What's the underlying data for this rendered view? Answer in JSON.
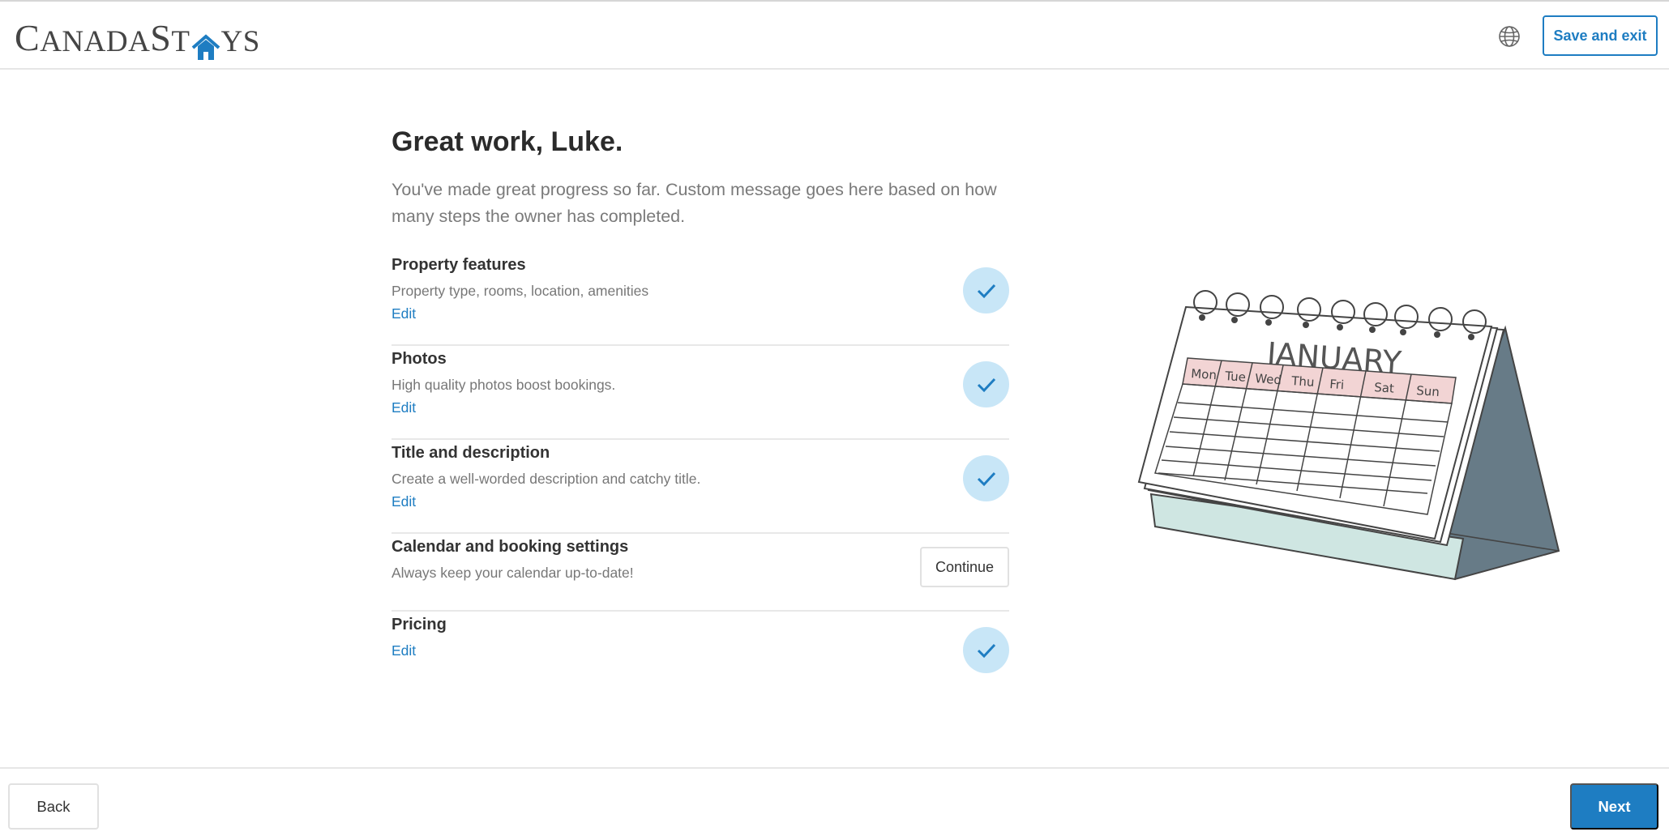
{
  "brand": {
    "logo_part1": "C",
    "logo_part2": "ANADA",
    "logo_part3": "S",
    "logo_part4": "T",
    "logo_part5": "YS",
    "name": "CanadaStays"
  },
  "header": {
    "save_exit_label": "Save and exit",
    "globe_icon": "globe-icon"
  },
  "main": {
    "title": "Great work, Luke.",
    "subtitle": "You've made great progress so far. Custom message goes here based on how many steps the owner has completed."
  },
  "steps": [
    {
      "title": "Property features",
      "description": "Property type, rooms, location, amenities",
      "action": "Edit",
      "status": "complete"
    },
    {
      "title": "Photos",
      "description": "High quality photos boost bookings.",
      "action": "Edit",
      "status": "complete"
    },
    {
      "title": "Title and description",
      "description": "Create a well-worded description and catchy title.",
      "action": "Edit",
      "status": "complete"
    },
    {
      "title": "Calendar and booking settings",
      "description": "Always keep your calendar up-to-date!",
      "action": "Continue",
      "status": "incomplete"
    },
    {
      "title": "Pricing",
      "description": "",
      "action": "Edit",
      "status": "complete"
    }
  ],
  "illustration": {
    "month": "JANUARY",
    "days": [
      "Mon",
      "Tue",
      "Wed",
      "Thu",
      "Fri",
      "Sat",
      "Sun"
    ]
  },
  "footer": {
    "back_label": "Back",
    "next_label": "Next"
  },
  "colors": {
    "accent": "#1e7dc2",
    "check_bg": "#c8e6f7",
    "calendar_header": "#f2d4d4",
    "calendar_base": "#cfe6e2",
    "calendar_stand": "#677b87"
  }
}
